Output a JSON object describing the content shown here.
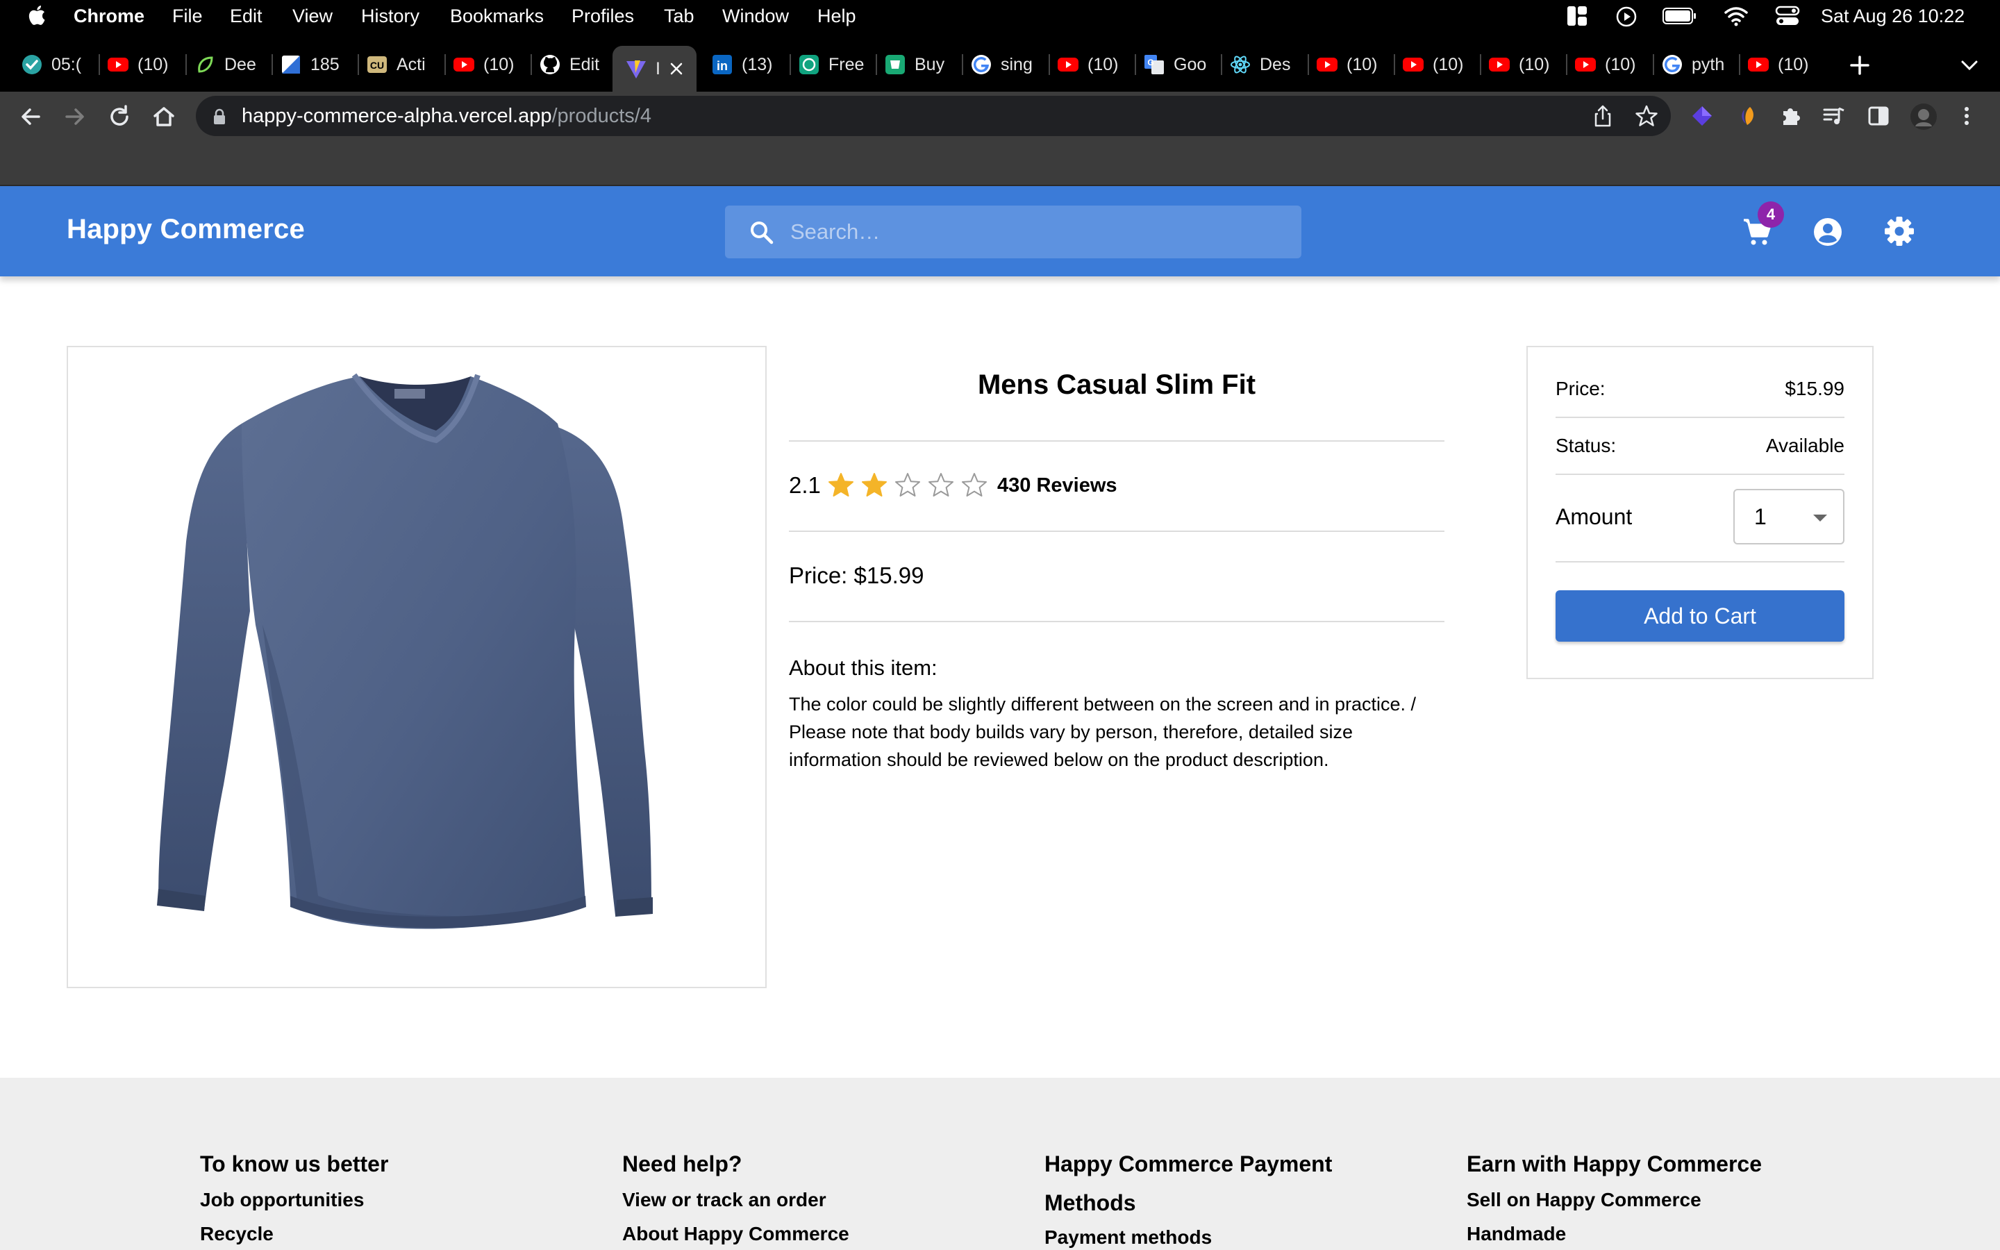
{
  "menubar": {
    "app": "Chrome",
    "items": [
      "File",
      "Edit",
      "View",
      "History",
      "Bookmarks",
      "Profiles",
      "Tab",
      "Window",
      "Help"
    ],
    "datetime": "Sat Aug 26  10:22"
  },
  "tabs": [
    {
      "label": "05:(",
      "icon": "check-circle-icon"
    },
    {
      "label": "(10)",
      "icon": "youtube-icon"
    },
    {
      "label": "Dee",
      "icon": "leaf-icon"
    },
    {
      "label": "185",
      "icon": "doc-icon"
    },
    {
      "label": "Acti",
      "icon": "cu-logo-icon"
    },
    {
      "label": "(10)",
      "icon": "youtube-icon"
    },
    {
      "label": "Edit",
      "icon": "github-icon"
    },
    {
      "label": "I",
      "icon": "vite-icon",
      "active": true
    },
    {
      "label": "(13)",
      "icon": "linkedin-icon"
    },
    {
      "label": "Free",
      "icon": "openai-icon"
    },
    {
      "label": "Buy",
      "icon": "buy-icon"
    },
    {
      "label": "sing",
      "icon": "google-icon"
    },
    {
      "label": "(10)",
      "icon": "youtube-icon"
    },
    {
      "label": "Goo",
      "icon": "translate-icon"
    },
    {
      "label": "Des",
      "icon": "react-icon"
    },
    {
      "label": "(10)",
      "icon": "youtube-icon"
    },
    {
      "label": "(10)",
      "icon": "youtube-icon"
    },
    {
      "label": "(10)",
      "icon": "youtube-icon"
    },
    {
      "label": "(10)",
      "icon": "youtube-icon"
    },
    {
      "label": "pyth",
      "icon": "google-icon"
    },
    {
      "label": "(10)",
      "icon": "youtube-icon"
    }
  ],
  "browser": {
    "url_host": "happy-commerce-alpha.vercel.app",
    "url_path": "/products/4"
  },
  "app": {
    "brand": "Happy Commerce",
    "search_placeholder": "Search…",
    "cart_count": "4"
  },
  "product": {
    "title": "Mens Casual Slim Fit",
    "rating": "2.1",
    "rating_value": 2.1,
    "rating_max": 5,
    "reviews": "430 Reviews",
    "price_line": "Price: $15.99",
    "about_title": "About this item:",
    "about_text": "The color could be slightly different between on the screen and in practice. / Please note that body builds vary by person, therefore, detailed size information should be reviewed below on the product description."
  },
  "buybox": {
    "price_label": "Price:",
    "price_value": "$15.99",
    "status_label": "Status:",
    "status_value": "Available",
    "amount_label": "Amount",
    "amount_value": "1",
    "add_to_cart": "Add to Cart"
  },
  "footer": {
    "columns": [
      {
        "title": "To know us better",
        "links": [
          "Job opportunities",
          "Recycle"
        ]
      },
      {
        "title": "Need help?",
        "links": [
          "View or track an order",
          "About Happy Commerce"
        ]
      },
      {
        "title": "Happy Commerce Payment Methods",
        "links": [
          "Payment methods"
        ]
      },
      {
        "title": "Earn with Happy Commerce",
        "links": [
          "Sell on Happy Commerce",
          "Handmade"
        ]
      }
    ]
  },
  "colors": {
    "appbar": "#3b7bd8",
    "button": "#3672cd",
    "star": "#f4b428",
    "badge": "#8e24aa"
  }
}
